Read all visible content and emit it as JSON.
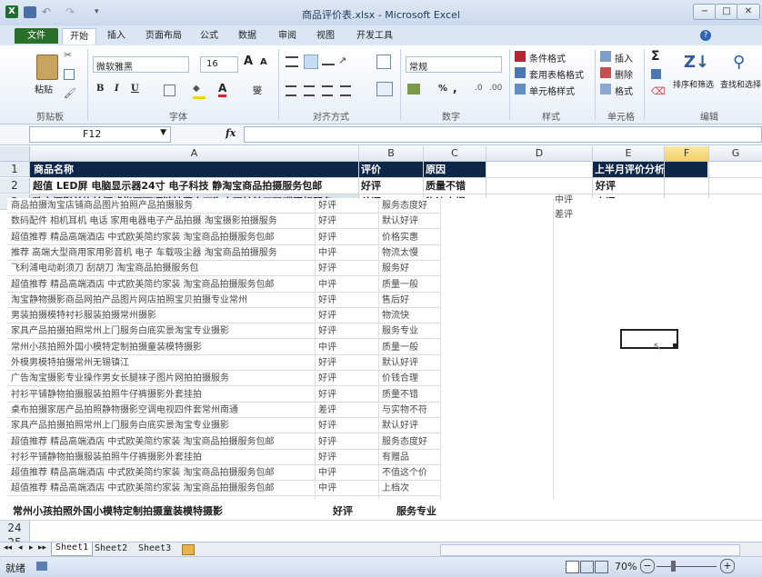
{
  "window": {
    "title": "商品评价表.xlsx - Microsoft Excel",
    "minimize": "−",
    "maximize": "□",
    "close": "✕",
    "app_letter": "X"
  },
  "tabs": [
    "文件",
    "开始",
    "插入",
    "页面布局",
    "公式",
    "数据",
    "审阅",
    "视图",
    "开发工具"
  ],
  "ribbon": {
    "clipboard": {
      "paste": "粘贴",
      "group": "剪贴板"
    },
    "font": {
      "name": "微软雅黑",
      "size": "16",
      "grow": "A",
      "shrink": "A",
      "bold": "B",
      "italic": "I",
      "underline": "U",
      "font_color": "A",
      "phonetic": "燮",
      "group": "字体"
    },
    "alignment": {
      "group": "对齐方式"
    },
    "number": {
      "format": "常规",
      "percent": "%",
      "comma": ",",
      "group": "数字"
    },
    "styles": {
      "conditional": "条件格式",
      "table": "套用表格格式",
      "cell": "单元格样式",
      "group": "样式"
    },
    "cells": {
      "insert": "插入",
      "delete": "删除",
      "format": "格式",
      "group": "单元格"
    },
    "editing": {
      "sum": "Σ",
      "sort_filter": "排序和筛选",
      "find_select": "查找和选择",
      "group": "编辑"
    }
  },
  "formula_bar": {
    "name_box": "F12",
    "fx": "fx",
    "value": ""
  },
  "columns": [
    "A",
    "B",
    "C",
    "D",
    "E",
    "F",
    "G"
  ],
  "rows_top": [
    {
      "n": "1",
      "a": "商品名称",
      "b": "评价",
      "c": "原因",
      "d": "",
      "e": "上半月评价分析",
      "f": ""
    },
    {
      "n": "2",
      "a": "超值 LED屏 电脑显示器24寸 电子科技 静淘宝商品拍摄服务包邮",
      "b": "好评",
      "c": "质量不错",
      "d": "",
      "e": "好评",
      "f": ""
    },
    {
      "n": "3",
      "a": "珠宝摄影首饰拍摄戒指耳环项链拍照宝石淘宝网拍钻石玛瑙照相服务",
      "b": "差评",
      "c": "物流太慢",
      "d": "",
      "e": "中评",
      "f": ""
    }
  ],
  "overlay_list": [
    {
      "a": "商品拍摄淘宝店铺商品图片拍照产品拍摄服务",
      "b": "好评",
      "c": "服务态度好"
    },
    {
      "a": "数码配件 相机耳机 电话 家用电器电子产品拍摄 淘宝摄影拍摄服务",
      "b": "好评",
      "c": "默认好评"
    },
    {
      "a": "超值推荐 精品高端酒店 中式欧美简约家装 淘宝商品拍摄服务包邮",
      "b": "好评",
      "c": "价格实惠"
    },
    {
      "a": "推荐 高端大型商用家用影音机 电子 车载吸尘器 淘宝商品拍摄服务",
      "b": "中评",
      "c": "物流太慢"
    },
    {
      "a": "飞利浦电动剃须刀 刮胡刀 淘宝商品拍摄服务包",
      "b": "好评",
      "c": "服务好"
    },
    {
      "a": "超值推荐 精品高端酒店 中式欧美简约家装 淘宝商品拍摄服务包邮",
      "b": "中评",
      "c": "质量一般"
    },
    {
      "a": "淘宝静物摄影商品网拍产品图片网店拍照宝贝拍摄专业常州",
      "b": "好评",
      "c": "售后好"
    },
    {
      "a": "男装拍摄模特衬衫服装拍摄常州摄影",
      "b": "好评",
      "c": "物流快"
    },
    {
      "a": "家具产品拍摄拍照常州上门服务白底实景淘宝专业摄影",
      "b": "好评",
      "c": "服务专业"
    },
    {
      "a": "常州小孩拍照外国小模特定制拍摄童装模特摄影",
      "b": "中评",
      "c": "质量一般"
    },
    {
      "a": "外模男模特拍摄常州无锡镇江",
      "b": "好评",
      "c": "默认好评"
    },
    {
      "a": "广告淘宝摄影专业操作男女长腿袜子图片网拍拍摄服务",
      "b": "好评",
      "c": "价钱合理"
    },
    {
      "a": "衬衫平铺静物拍摄服装拍照牛仔裤摄影外套挂拍",
      "b": "好评",
      "c": "质量不错"
    },
    {
      "a": "桌布拍摄家居产品拍照静物摄影空调电视四件套常州南通",
      "b": "差评",
      "c": "与实物不符"
    },
    {
      "a": "家具产品拍摄拍照常州上门服务白底实景淘宝专业摄影",
      "b": "好评",
      "c": "默认好评"
    },
    {
      "a": "超值推荐 精品高端酒店 中式欧美简约家装 淘宝商品拍摄服务包邮",
      "b": "好评",
      "c": "服务态度好"
    },
    {
      "a": "衬衫平铺静物拍摄服装拍照牛仔裤摄影外套挂拍",
      "b": "好评",
      "c": "有赠品"
    },
    {
      "a": "超值推荐 精品高端酒店 中式欧美简约家装 淘宝商品拍摄服务包邮",
      "b": "中评",
      "c": "不值这个价"
    },
    {
      "a": "超值推荐 精品高端酒店 中式欧美简约家装 淘宝商品拍摄服务包邮",
      "b": "中评",
      "c": "上档次"
    }
  ],
  "overlay_aside": [
    "中评",
    "差评"
  ],
  "row_bottom": {
    "a": "常州小孩拍照外国小模特定制拍摄童装模特摄影",
    "b": "好评",
    "c": "服务专业"
  },
  "row_numbers_bottom": [
    "24",
    "25"
  ],
  "sheets": [
    "Sheet1",
    "Sheet2",
    "Sheet3"
  ],
  "status": {
    "ready": "就绪",
    "zoom": "70%",
    "zoom_minus": "−",
    "zoom_plus": "+"
  },
  "colors": {
    "header_fill": "#0e2748",
    "file_tab": "#2a6f2a",
    "ribbon_bg": "#e7eff9"
  }
}
